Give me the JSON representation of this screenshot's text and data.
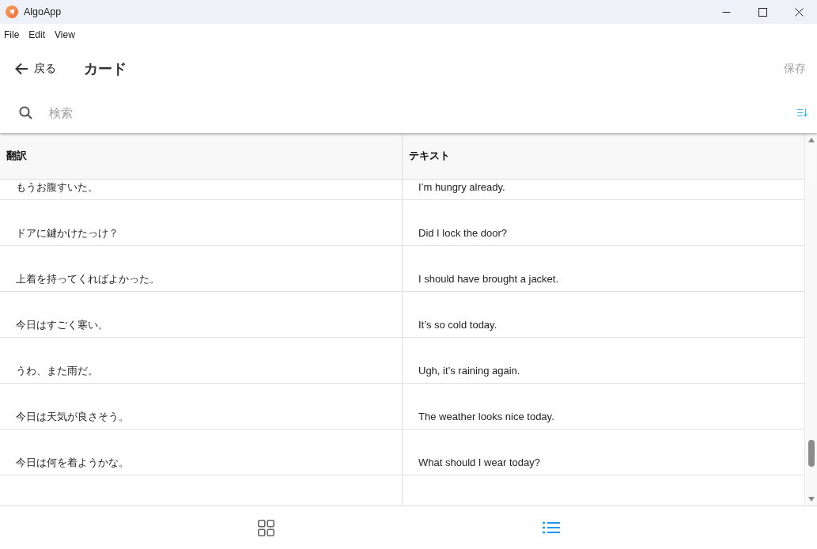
{
  "window": {
    "title": "AlgoApp"
  },
  "menu": [
    "File",
    "Edit",
    "View"
  ],
  "header": {
    "back": {
      "label": "戻る"
    },
    "title": "カード",
    "save": {
      "label": "保存",
      "disabled": true
    }
  },
  "search": {
    "placeholder": "検索"
  },
  "table": {
    "columns": [
      "翻訳",
      "テキスト"
    ],
    "rows": [
      {
        "cells": [
          "もうお腹すいた。",
          "I’m hungry already."
        ]
      },
      {
        "cells": [
          "ドアに鍵かけたっけ？",
          "Did I lock the door?"
        ]
      },
      {
        "cells": [
          "上着を持ってくればよかった。",
          "I should have brought a jacket."
        ]
      },
      {
        "cells": [
          "今日はすごく寒い。",
          "It’s so cold today."
        ]
      },
      {
        "cells": [
          "うわ、また雨だ。",
          "Ugh, it’s raining again."
        ]
      },
      {
        "cells": [
          "今日は天気が良さそう。",
          "The weather looks nice today."
        ]
      },
      {
        "cells": [
          "今日は何を着ようかな。",
          "What should I wear today?"
        ]
      }
    ]
  },
  "bottom_nav": [
    {
      "kind": "grid",
      "selected": false
    },
    {
      "kind": "list",
      "selected": true
    }
  ]
}
